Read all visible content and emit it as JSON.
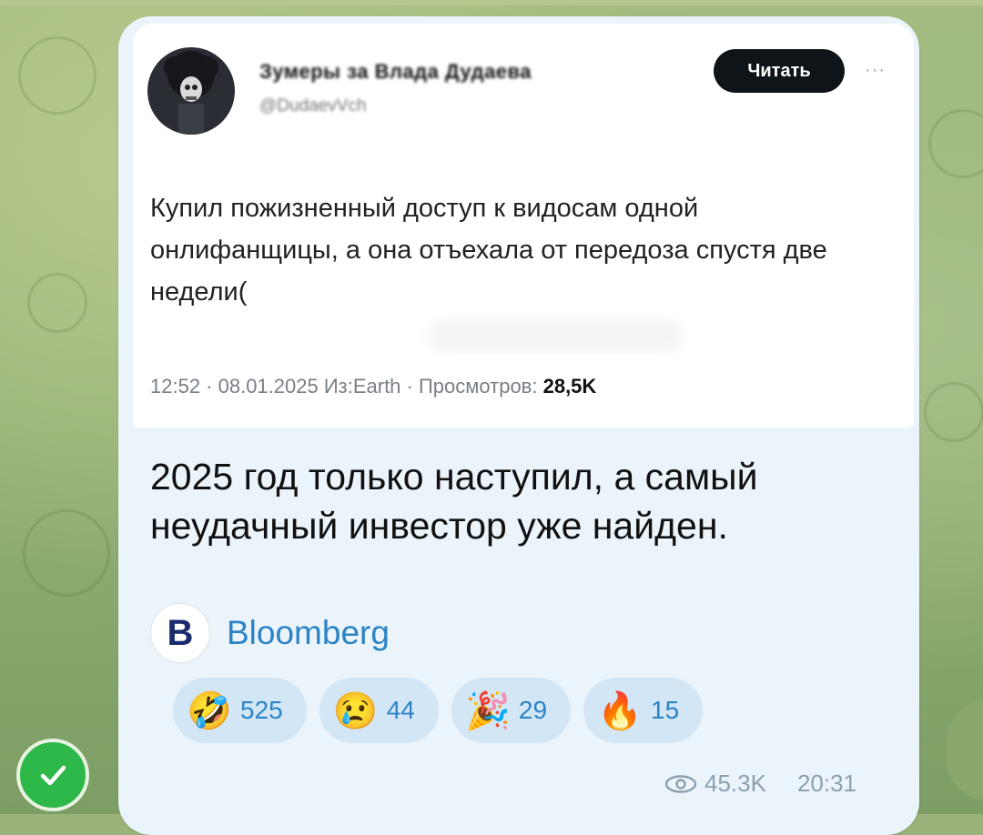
{
  "tweet": {
    "author_name": "Зумеры за Влада Дудаева",
    "author_handle": "@DudaevVch",
    "follow_label": "Читать",
    "more_label": "···",
    "text": "Купил пожизненный доступ к видосам одной онлифанщицы, а она отъехала от передоза спустя две недели(",
    "meta_prefix": "12:52 · 08.01.2025 Из:Earth · Просмотров: ",
    "meta_views": "28,5K"
  },
  "caption": "2025 год только наступил, а самый неудачный инвестор уже найден.",
  "link": {
    "icon": "B",
    "label": "Bloomberg"
  },
  "reactions": [
    {
      "emoji": "🤣",
      "count": "525"
    },
    {
      "emoji": "😢",
      "count": "44"
    },
    {
      "emoji": "🎉",
      "count": "29"
    },
    {
      "emoji": "🔥",
      "count": "15"
    }
  ],
  "footer": {
    "views": "45.3K",
    "time": "20:31"
  },
  "icons": {
    "views": "eye-icon",
    "verified": "checkmark-icon"
  },
  "colors": {
    "bubble": "#ebf4fb",
    "accent": "#2b84c5",
    "reaction_bg": "#d3e6f5",
    "check": "#2eb84a"
  }
}
